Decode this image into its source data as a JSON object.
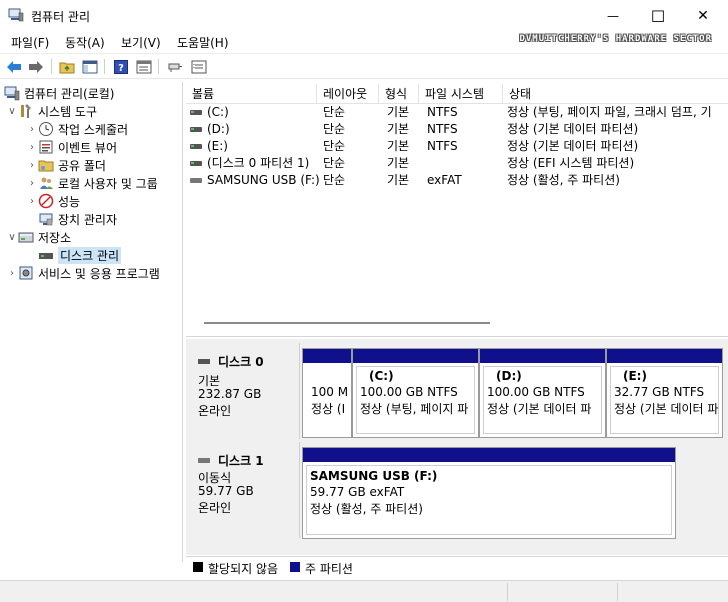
{
  "window": {
    "title": "컴퓨터 관리",
    "minimize_glyph": "—",
    "maximize_glyph": "☐",
    "close_glyph": "✕"
  },
  "watermark": "DVMUITCHERRY'S HARDWARE SECTOR",
  "menu": [
    "파일(F)",
    "동작(A)",
    "보기(V)",
    "도움말(H)"
  ],
  "toolbar": {
    "icons": [
      "back-arrow-icon",
      "forward-arrow-icon",
      "up-folder-icon",
      "show-hide-console-tree-icon",
      "help-icon",
      "properties-icon",
      "connect-icon",
      "list-icon"
    ]
  },
  "tree": {
    "items": [
      {
        "label": "컴퓨터 관리(로컬)",
        "icon": "computer-management-icon",
        "chevron": ""
      },
      {
        "label": "시스템 도구",
        "icon": "system-tools-icon",
        "chevron": "∨"
      },
      {
        "label": "작업 스케줄러",
        "icon": "clock-icon",
        "chevron": "›"
      },
      {
        "label": "이벤트 뷰어",
        "icon": "event-viewer-icon",
        "chevron": "›"
      },
      {
        "label": "공유 폴더",
        "icon": "shared-folder-icon",
        "chevron": "›"
      },
      {
        "label": "로컬 사용자 및 그룹",
        "icon": "users-icon",
        "chevron": "›"
      },
      {
        "label": "성능",
        "icon": "performance-icon",
        "chevron": "›"
      },
      {
        "label": "장치 관리자",
        "icon": "device-manager-icon",
        "chevron": ""
      },
      {
        "label": "저장소",
        "icon": "storage-icon",
        "chevron": "∨"
      },
      {
        "label": "디스크 관리",
        "icon": "disk-management-icon",
        "chevron": ""
      },
      {
        "label": "서비스 및 응용 프로그램",
        "icon": "services-icon",
        "chevron": "›"
      }
    ]
  },
  "volumes": {
    "headers": [
      "볼륨",
      "레이아웃",
      "형식",
      "파일 시스템",
      "상태"
    ],
    "rows": [
      {
        "name": "(C:)",
        "layout": "단순",
        "type": "기본",
        "fs": "NTFS",
        "status": "정상 (부팅, 페이지 파일, 크래시 덤프, 기",
        "usb": false
      },
      {
        "name": "(D:)",
        "layout": "단순",
        "type": "기본",
        "fs": "NTFS",
        "status": "정상 (기본 데이터 파티션)",
        "usb": false
      },
      {
        "name": "(E:)",
        "layout": "단순",
        "type": "기본",
        "fs": "NTFS",
        "status": "정상 (기본 데이터 파티션)",
        "usb": false
      },
      {
        "name": "(디스크 0 파티션 1)",
        "layout": "단순",
        "type": "기본",
        "fs": "",
        "status": "정상 (EFI 시스템 파티션)",
        "usb": false
      },
      {
        "name": "SAMSUNG USB (F:)",
        "layout": "단순",
        "type": "기본",
        "fs": "exFAT",
        "status": "정상 (활성, 주 파티션)",
        "usb": true
      }
    ]
  },
  "disks": [
    {
      "title": "디스크 0",
      "kind": "기본",
      "size": "232.87 GB",
      "state": "온라인",
      "partitions": [
        {
          "name": "",
          "line1": "100 M",
          "line2": "정상 (I"
        },
        {
          "name": "(C:)",
          "line1": "100.00 GB NTFS",
          "line2": "정상 (부팅, 페이지 파"
        },
        {
          "name": "(D:)",
          "line1": "100.00 GB NTFS",
          "line2": "정상 (기본 데이터 파"
        },
        {
          "name": "(E:)",
          "line1": "32.77 GB NTFS",
          "line2": "정상 (기본 데이터 파"
        }
      ]
    },
    {
      "title": "디스크 1",
      "kind": "이동식",
      "size": "59.77 GB",
      "state": "온라인",
      "partitions": [
        {
          "name": "SAMSUNG USB  (F:)",
          "line1": "59.77 GB exFAT",
          "line2": "정상 (활성, 주 파티션)"
        }
      ]
    }
  ],
  "legend": [
    {
      "label": "할당되지 않음",
      "color": "#000000"
    },
    {
      "label": "주 파티션",
      "color": "#10108c"
    }
  ]
}
